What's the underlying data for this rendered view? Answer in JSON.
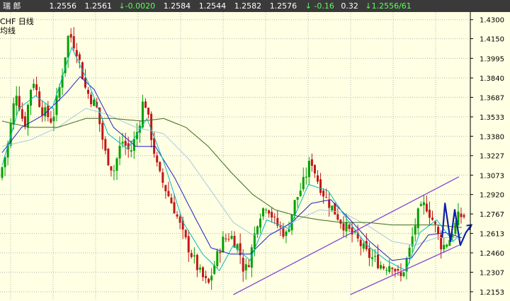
{
  "quote_bar": {
    "name": "瑞    郎",
    "v1": "1.2556",
    "v2": "1.2561",
    "change": "↓-0.0020",
    "v3": "1.2584",
    "v4": "1.2544",
    "v5": "1.2582",
    "v6": "1.2576",
    "pct": "↓ -0.16",
    "v7": "0.32",
    "last": "↓1.2556/61"
  },
  "symbol": {
    "line1": "CHF   日线",
    "line2": "均线"
  },
  "colors": {
    "background": "#ffffe3",
    "up_bar": "#00a000",
    "down_bar": "#c01818",
    "ma_fast": "#00b8c0",
    "ma_mid": "#2020c0",
    "ma_slow": "#3a6a1e",
    "ma_light": "#a8c8e0",
    "channel": "#7a3cd6",
    "projection": "#0e1ea8",
    "grid": "#b8b8b8"
  },
  "chart_data": {
    "type": "candlestick",
    "ylim": [
      1.208,
      1.436
    ],
    "yticks": [
      "1.4300",
      "1.4150",
      "1.3995",
      "1.3840",
      "1.3687",
      "1.3533",
      "1.3380",
      "1.3227",
      "1.3073",
      "1.2920",
      "1.2767",
      "1.2613",
      "1.2460",
      "1.2307",
      "1.2153"
    ],
    "n_bars": 162,
    "close_path": [
      [
        0,
        1.305
      ],
      [
        6,
        1.33
      ],
      [
        12,
        1.375
      ],
      [
        18,
        1.345
      ],
      [
        24,
        1.385
      ],
      [
        30,
        1.36
      ],
      [
        38,
        1.35
      ],
      [
        44,
        1.38
      ],
      [
        50,
        1.42
      ],
      [
        56,
        1.405
      ],
      [
        62,
        1.375
      ],
      [
        70,
        1.36
      ],
      [
        76,
        1.325
      ],
      [
        82,
        1.31
      ],
      [
        88,
        1.335
      ],
      [
        94,
        1.325
      ],
      [
        100,
        1.345
      ],
      [
        104,
        1.37
      ],
      [
        108,
        1.345
      ],
      [
        114,
        1.31
      ],
      [
        120,
        1.295
      ],
      [
        126,
        1.28
      ],
      [
        132,
        1.26
      ],
      [
        138,
        1.245
      ],
      [
        144,
        1.23
      ],
      [
        150,
        1.22
      ],
      [
        154,
        1.235
      ],
      [
        160,
        1.255
      ],
      [
        166,
        1.26
      ],
      [
        172,
        1.25
      ],
      [
        176,
        1.23
      ],
      [
        180,
        1.242
      ],
      [
        186,
        1.275
      ],
      [
        192,
        1.285
      ],
      [
        198,
        1.27
      ],
      [
        206,
        1.26
      ],
      [
        212,
        1.285
      ],
      [
        218,
        1.3
      ],
      [
        224,
        1.32
      ],
      [
        228,
        1.305
      ],
      [
        234,
        1.29
      ],
      [
        240,
        1.28
      ],
      [
        246,
        1.27
      ],
      [
        252,
        1.262
      ],
      [
        258,
        1.255
      ],
      [
        264,
        1.245
      ],
      [
        270,
        1.24
      ],
      [
        276,
        1.235
      ],
      [
        282,
        1.238
      ],
      [
        288,
        1.225
      ],
      [
        294,
        1.245
      ],
      [
        300,
        1.275
      ],
      [
        306,
        1.285
      ],
      [
        312,
        1.27
      ],
      [
        318,
        1.25
      ],
      [
        324,
        1.258
      ],
      [
        330,
        1.275
      ]
    ],
    "ma_fast_path": [
      [
        0,
        1.315
      ],
      [
        12,
        1.36
      ],
      [
        24,
        1.37
      ],
      [
        36,
        1.36
      ],
      [
        50,
        1.408
      ],
      [
        62,
        1.38
      ],
      [
        76,
        1.34
      ],
      [
        90,
        1.328
      ],
      [
        104,
        1.352
      ],
      [
        116,
        1.318
      ],
      [
        130,
        1.27
      ],
      [
        144,
        1.245
      ],
      [
        156,
        1.232
      ],
      [
        166,
        1.252
      ],
      [
        178,
        1.24
      ],
      [
        190,
        1.272
      ],
      [
        206,
        1.265
      ],
      [
        220,
        1.3
      ],
      [
        234,
        1.295
      ],
      [
        248,
        1.272
      ],
      [
        262,
        1.252
      ],
      [
        276,
        1.24
      ],
      [
        290,
        1.232
      ],
      [
        300,
        1.262
      ],
      [
        312,
        1.272
      ],
      [
        324,
        1.255
      ],
      [
        330,
        1.262
      ]
    ],
    "ma_mid_path": [
      [
        0,
        1.325
      ],
      [
        14,
        1.345
      ],
      [
        30,
        1.355
      ],
      [
        46,
        1.372
      ],
      [
        56,
        1.385
      ],
      [
        66,
        1.375
      ],
      [
        80,
        1.345
      ],
      [
        96,
        1.33
      ],
      [
        110,
        1.33
      ],
      [
        124,
        1.305
      ],
      [
        138,
        1.275
      ],
      [
        150,
        1.25
      ],
      [
        164,
        1.245
      ],
      [
        178,
        1.245
      ],
      [
        192,
        1.26
      ],
      [
        208,
        1.27
      ],
      [
        222,
        1.285
      ],
      [
        236,
        1.288
      ],
      [
        250,
        1.272
      ],
      [
        264,
        1.255
      ],
      [
        280,
        1.24
      ],
      [
        294,
        1.242
      ],
      [
        306,
        1.26
      ],
      [
        318,
        1.262
      ],
      [
        330,
        1.258
      ]
    ],
    "ma_slow_path": [
      [
        0,
        1.35
      ],
      [
        20,
        1.345
      ],
      [
        40,
        1.345
      ],
      [
        60,
        1.352
      ],
      [
        80,
        1.352
      ],
      [
        100,
        1.35
      ],
      [
        116,
        1.352
      ],
      [
        132,
        1.345
      ],
      [
        148,
        1.33
      ],
      [
        164,
        1.31
      ],
      [
        180,
        1.292
      ],
      [
        196,
        1.28
      ],
      [
        212,
        1.275
      ],
      [
        228,
        1.272
      ],
      [
        244,
        1.27
      ],
      [
        262,
        1.27
      ],
      [
        280,
        1.268
      ],
      [
        296,
        1.268
      ],
      [
        312,
        1.268
      ],
      [
        330,
        1.266
      ]
    ],
    "ma_light_path": [
      [
        0,
        1.33
      ],
      [
        20,
        1.335
      ],
      [
        40,
        1.345
      ],
      [
        60,
        1.36
      ],
      [
        76,
        1.355
      ],
      [
        96,
        1.345
      ],
      [
        116,
        1.34
      ],
      [
        134,
        1.32
      ],
      [
        150,
        1.295
      ],
      [
        166,
        1.27
      ],
      [
        180,
        1.26
      ],
      [
        196,
        1.262
      ],
      [
        212,
        1.272
      ],
      [
        228,
        1.28
      ],
      [
        244,
        1.278
      ],
      [
        262,
        1.268
      ],
      [
        280,
        1.255
      ],
      [
        296,
        1.252
      ],
      [
        312,
        1.258
      ],
      [
        330,
        1.258
      ]
    ],
    "channel_lines": [
      {
        "from": [
          166,
          1.213
        ],
        "to": [
          328,
          1.306
        ]
      },
      {
        "from": [
          250,
          1.213
        ],
        "to": [
          328,
          1.252
        ]
      }
    ],
    "projection_path": [
      [
        316,
        1.258
      ],
      [
        318,
        1.285
      ],
      [
        322,
        1.255
      ],
      [
        325,
        1.28
      ],
      [
        329,
        1.252
      ],
      [
        333,
        1.262
      ],
      [
        337,
        1.268
      ]
    ]
  }
}
